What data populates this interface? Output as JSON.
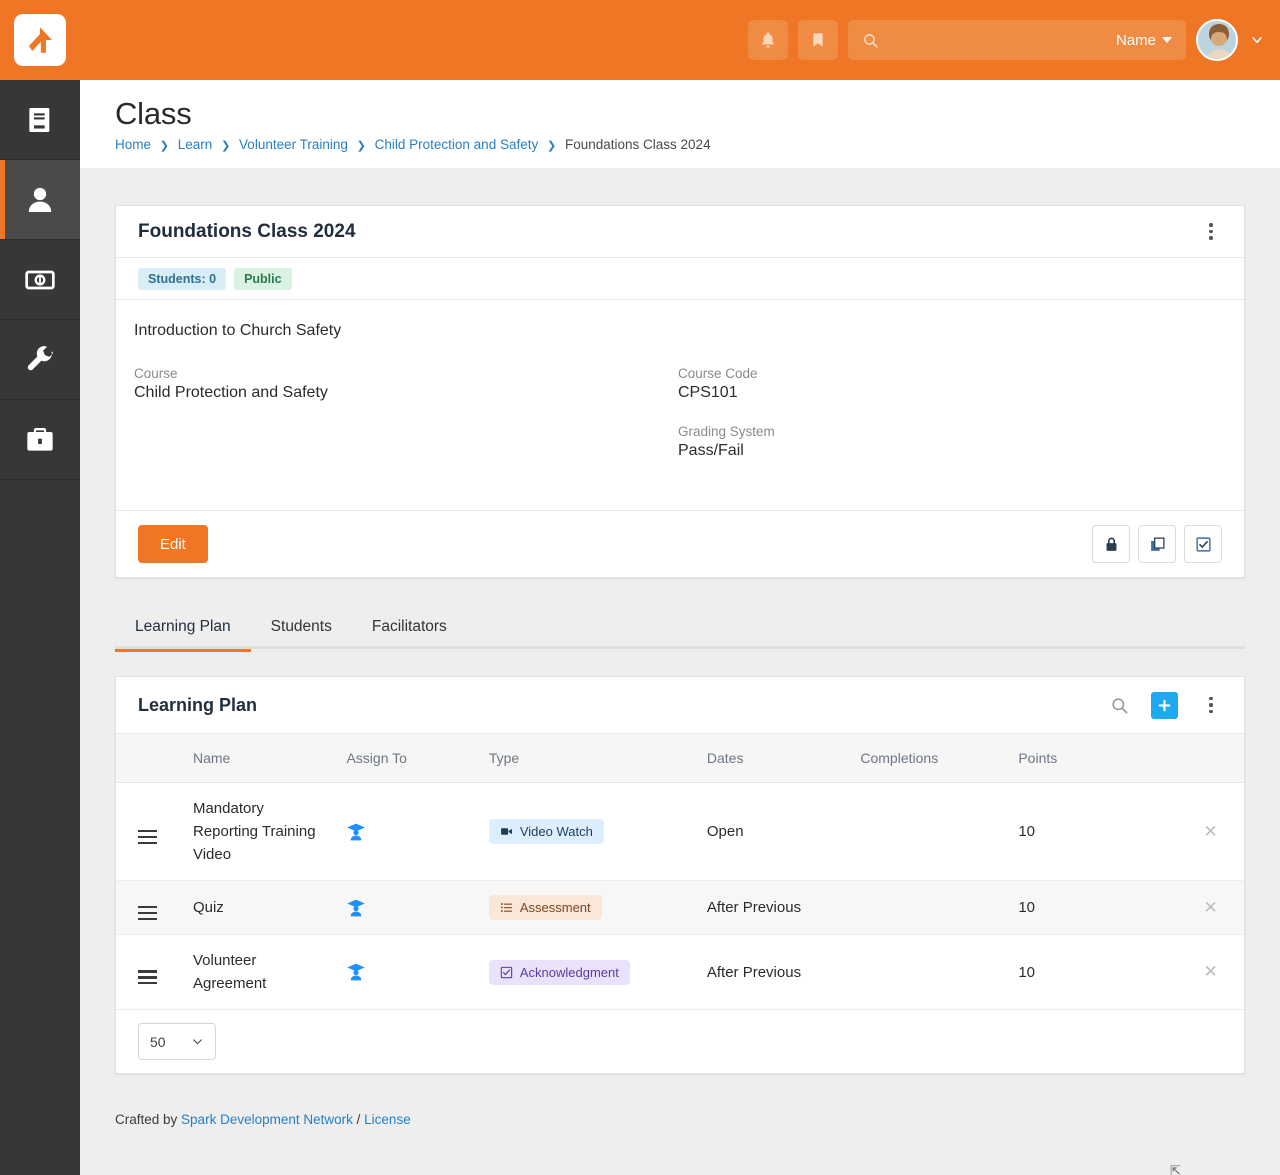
{
  "topbar": {
    "logo_name": "rock-rms-logo",
    "notifications_icon": "bell-icon",
    "bookmarks_icon": "bookmark-icon",
    "search_icon": "search-icon",
    "search_value": "",
    "search_placeholder": "",
    "name_selector": "Name",
    "avatar_name": "user-avatar",
    "brand_color": "#ee7624"
  },
  "sidebar": {
    "items": [
      {
        "icon": "book-icon",
        "name": "cms",
        "active": false
      },
      {
        "icon": "person-icon",
        "name": "people",
        "active": true
      },
      {
        "icon": "money-icon",
        "name": "finance",
        "active": false
      },
      {
        "icon": "wrench-icon",
        "name": "tools",
        "active": false
      },
      {
        "icon": "briefcase-icon",
        "name": "admin",
        "active": false
      }
    ]
  },
  "page": {
    "title": "Class",
    "breadcrumb": [
      {
        "label": "Home",
        "link": true
      },
      {
        "label": "Learn",
        "link": true
      },
      {
        "label": "Volunteer Training",
        "link": true
      },
      {
        "label": "Child Protection and Safety",
        "link": true
      },
      {
        "label": "Foundations Class 2024",
        "link": false
      }
    ]
  },
  "class_card": {
    "title": "Foundations Class 2024",
    "kebab_name": "card-options-menu",
    "labels": [
      {
        "text": "Students: 0",
        "style": "info"
      },
      {
        "text": "Public",
        "style": "success"
      }
    ],
    "description": "Introduction to Church Safety",
    "fields_left": [
      {
        "label": "Course",
        "value": "Child Protection and Safety"
      }
    ],
    "fields_right": [
      {
        "label": "Course Code",
        "value": "CPS101"
      },
      {
        "label": "Grading System",
        "value": "Pass/Fail"
      }
    ],
    "edit_button": "Edit",
    "actions": [
      {
        "icon": "lock-icon",
        "name": "security-button"
      },
      {
        "icon": "copy-icon",
        "name": "copy-button"
      },
      {
        "icon": "checkbox-icon",
        "name": "attendance-button"
      }
    ]
  },
  "tabs": [
    {
      "label": "Learning Plan",
      "active": true
    },
    {
      "label": "Students",
      "active": false
    },
    {
      "label": "Facilitators",
      "active": false
    }
  ],
  "learning_plan": {
    "panel_title": "Learning Plan",
    "search_icon": "search-icon",
    "add_label": "+",
    "kebab_name": "panel-options-menu",
    "columns": [
      "",
      "Name",
      "Assign To",
      "Type",
      "Dates",
      "Completions",
      "Points",
      ""
    ],
    "rows": [
      {
        "name": "Mandatory Reporting Training Video",
        "assign_to_icon": "student-icon",
        "type": "Video Watch",
        "type_style": "video",
        "type_icon": "video-icon",
        "dates": "Open",
        "completions": "",
        "points": "10",
        "delete_icon": "close-icon"
      },
      {
        "name": "Quiz",
        "assign_to_icon": "student-icon",
        "type": "Assessment",
        "type_style": "assessment",
        "type_icon": "list-icon",
        "dates": "After Previous",
        "completions": "",
        "points": "10",
        "delete_icon": "close-icon"
      },
      {
        "name": "Volunteer Agreement",
        "assign_to_icon": "student-icon",
        "type": "Acknowledgment",
        "type_style": "acknowledgment",
        "type_icon": "checkbox-icon",
        "dates": "After Previous",
        "completions": "",
        "points": "10",
        "delete_icon": "close-icon"
      }
    ],
    "page_size": "50"
  },
  "footer": {
    "crafted_by": "Crafted by",
    "spark_link": "Spark Development Network",
    "separator": "/",
    "license_link": "License"
  }
}
